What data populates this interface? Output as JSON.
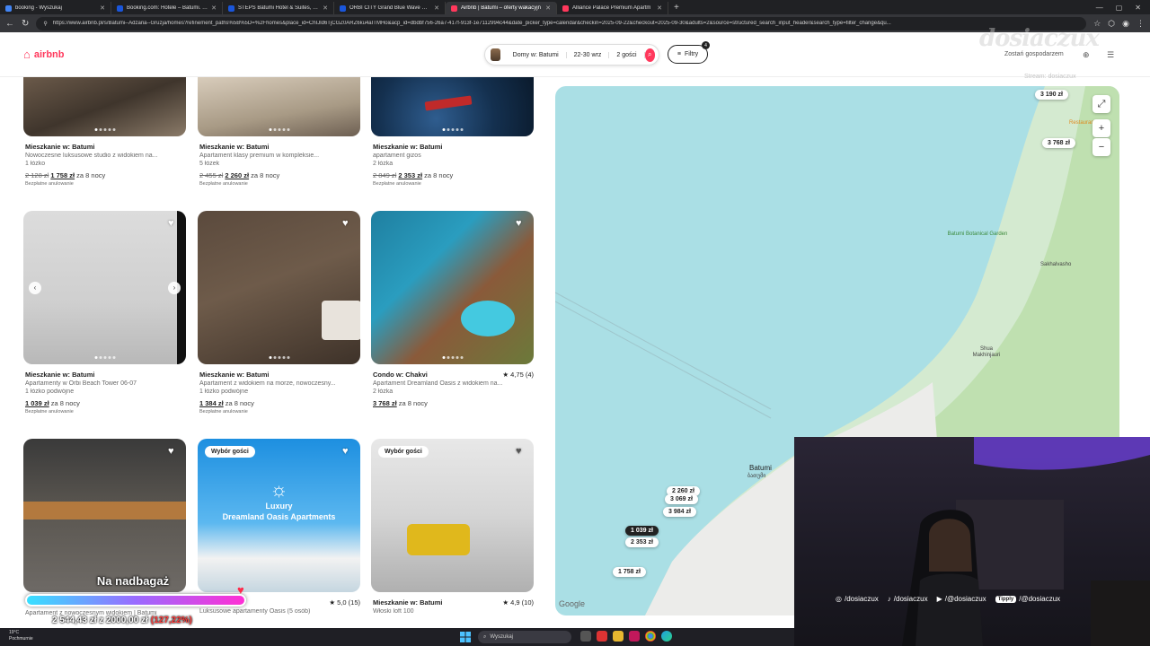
{
  "browser": {
    "tabs": [
      {
        "title": "booking - Wyszukaj",
        "color": "#4285f4",
        "active": false
      },
      {
        "title": "Booking.com: Hotele – Batumi. Zar",
        "color": "#1a56db",
        "active": false
      },
      {
        "title": "STEPS Batumi Hotel & Suites, Bat",
        "color": "#1a56db",
        "active": false
      },
      {
        "title": "ORBI CITY Grand Blue Wave Suite",
        "color": "#1a56db",
        "active": false
      },
      {
        "title": "Airbnb | Batumi – oferty wakacyjn",
        "color": "#ff385c",
        "active": true
      },
      {
        "title": "Alliance Palace Premium Apartm",
        "color": "#ff385c",
        "active": false
      }
    ],
    "url": "https://www.airbnb.pl/s/Batumi--Adżaria--Gruzja/homes?refinement_paths%5B%5D=%2Fhomes&place_id=ChIJld6TjCGZ0ARZ6ku4aITMHo&acp_id=dbdbf756-26a7-417f-913f-1e7112994c44&date_picker_type=calendar&checkin=2025-09-22&checkout=2025-09-30&adults=2&source=structured_search_input_header&search_type=filter_change&qu..."
  },
  "header": {
    "logo": "airbnb",
    "search": {
      "location": "Domy w: Batumi",
      "dates": "22-30 wrz",
      "guests": "2 gości"
    },
    "filters": {
      "label": "Filtry",
      "count": "4"
    },
    "host_label": "Zostań gospodarzem"
  },
  "listings": [
    {
      "title": "Mieszkanie w: Batumi",
      "desc": "Nowoczesne luksusowe studio z widokiem na...",
      "beds": "1 łóżko",
      "old_price": "2 128 zł",
      "price": "1 758 zł",
      "nights": "za 8 nocy",
      "cancel": "Bezpłatne anulowanie"
    },
    {
      "title": "Mieszkanie w: Batumi",
      "desc": "Apartament klasy premium w kompleksie...",
      "beds": "5 łóżek",
      "old_price": "2 455 zł",
      "price": "2 260 zł",
      "nights": "za 8 nocy",
      "cancel": "Bezpłatne anulowanie"
    },
    {
      "title": "Mieszkanie w: Batumi",
      "desc": "apartament gizos",
      "beds": "2 łóżka",
      "old_price": "2 849 zł",
      "price": "2 353 zł",
      "nights": "za 8 nocy",
      "cancel": "Bezpłatne anulowanie"
    },
    {
      "title": "Mieszkanie w: Batumi",
      "desc": "Apartamenty w Orbi Beach Tower 06-07",
      "beds": "1 łóżko podwójne",
      "old_price": "",
      "price": "1 039 zł",
      "nights": "za 8 nocy",
      "cancel": "Bezpłatne anulowanie"
    },
    {
      "title": "Mieszkanie w: Batumi",
      "desc": "Apartament z widokiem na morze, nowoczesny...",
      "beds": "1 łóżko podwójne",
      "old_price": "",
      "price": "1 384 zł",
      "nights": "za 8 nocy",
      "cancel": "Bezpłatne anulowanie"
    },
    {
      "title": "Condo w: Chakvi",
      "rating": "★ 4,75 (4)",
      "desc": "Apartament Dreamland Oasis z widokiem na...",
      "beds": "2 łóżka",
      "old_price": "",
      "price": "3 768 zł",
      "nights": "za 8 nocy",
      "cancel": ""
    },
    {
      "title": "",
      "desc": "Apartament z nowoczesnym widokiem | Batumi",
      "badge": ""
    },
    {
      "title": "",
      "rating": "★ 5,0 (15)",
      "desc": "Luksusowe apartamenty Oasis (5 osób)",
      "badge": "Wybór gości",
      "image_text_1": "Luxury",
      "image_text_2": "Dreamland Oasis Apartments"
    },
    {
      "title": "Mieszkanie w: Batumi",
      "rating": "★ 4,9 (10)",
      "desc": "Włoski loft 100",
      "badge": "Wybór gości"
    }
  ],
  "map": {
    "pins": [
      {
        "label": "3 190 zł"
      },
      {
        "label": "3 768 zł"
      },
      {
        "label": "2 260 zł"
      },
      {
        "label": "3 069 zł"
      },
      {
        "label": "3 984 zł"
      },
      {
        "label": "1 039 zł"
      },
      {
        "label": "2 353 zł"
      },
      {
        "label": "1 758 zł"
      }
    ],
    "places": {
      "botanic": "Batumi Botanical Garden",
      "sakhalvasho": "Sakhalvasho",
      "shua": "Shua Makhinjauri",
      "batumi": "Batumi",
      "batumi_ka": "ბათუმი",
      "restaurant": "Restaurant"
    },
    "google": "Google",
    "zoom_in": "+",
    "zoom_out": "−",
    "expand_icon": "expand-icon"
  },
  "overlay": {
    "logo": "dosiaczux",
    "sub": "Stream: dosiaczux",
    "goal": {
      "title": "Na nadbagaż",
      "amount": "2 544,43 zł z 2000,00 zł",
      "over": "(127,22%)",
      "progress": 1.0
    },
    "socials": [
      {
        "icon": "instagram-icon",
        "glyph": "◎",
        "handle": "/dosiaczux"
      },
      {
        "icon": "tiktok-icon",
        "glyph": "♪",
        "handle": "/dosiaczux"
      },
      {
        "icon": "youtube-icon",
        "glyph": "▶",
        "handle": "/@dosiaczux"
      },
      {
        "icon": "tipply-icon",
        "glyph": "Tipply",
        "handle": "/@dosiaczux"
      }
    ]
  },
  "taskbar": {
    "weather_temp": "19°C",
    "weather_desc": "Pochmurnie",
    "search": "Wyszukaj"
  }
}
